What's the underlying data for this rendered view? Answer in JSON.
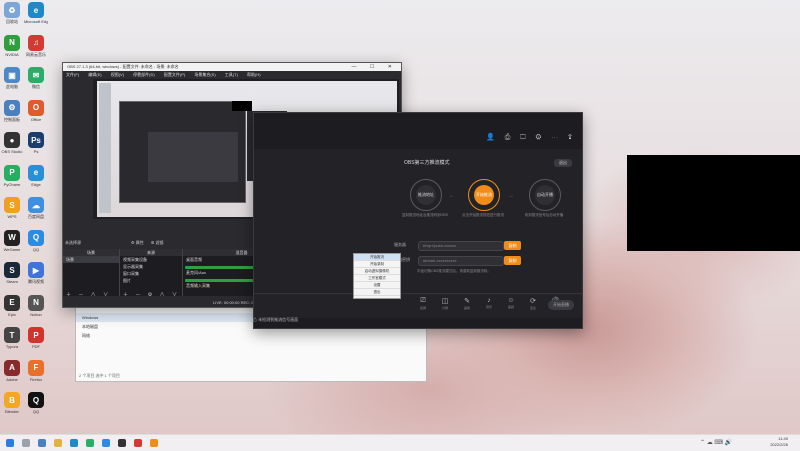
{
  "desktop": {
    "icons": [
      {
        "label": "回收站",
        "color": "#7aa6d8",
        "glyph": "♻"
      },
      {
        "label": "Microsoft Edge",
        "color": "#1e88c8",
        "glyph": "e"
      },
      {
        "label": "NVIDIA",
        "color": "#2f9e3f",
        "glyph": "N"
      },
      {
        "label": "网易云音乐",
        "color": "#d33b32",
        "glyph": "♫"
      },
      {
        "label": "此电脑",
        "color": "#4a88c7",
        "glyph": "▣"
      },
      {
        "label": "微信",
        "color": "#2aae67",
        "glyph": "✉"
      },
      {
        "label": "控制面板",
        "color": "#4a7fc0",
        "glyph": "⚙"
      },
      {
        "label": "Office",
        "color": "#e05a2b",
        "glyph": "O"
      },
      {
        "label": "OBS Studio",
        "color": "#333333",
        "glyph": "●"
      },
      {
        "label": "Ps",
        "color": "#1c3c6e",
        "glyph": "Ps"
      },
      {
        "label": "PyCharm",
        "color": "#27ae60",
        "glyph": "P"
      },
      {
        "label": "Edge",
        "color": "#2c8fd6",
        "glyph": "e"
      },
      {
        "label": "WPS",
        "color": "#f0a020",
        "glyph": "S"
      },
      {
        "label": "百度网盘",
        "color": "#3f8fe0",
        "glyph": "☁"
      },
      {
        "label": "WeGame",
        "color": "#222222",
        "glyph": "W"
      },
      {
        "label": "QQ",
        "color": "#2d8be3",
        "glyph": "Q"
      },
      {
        "label": "Steam",
        "color": "#1b2838",
        "glyph": "S"
      },
      {
        "label": "腾讯视频",
        "color": "#3f74d8",
        "glyph": "▶"
      },
      {
        "label": "Epic",
        "color": "#333333",
        "glyph": "E"
      },
      {
        "label": "Notion",
        "color": "#555555",
        "glyph": "N"
      },
      {
        "label": "Typora",
        "color": "#444444",
        "glyph": "T"
      },
      {
        "label": "PDF",
        "color": "#d2332c",
        "glyph": "P"
      },
      {
        "label": "Adobe",
        "color": "#8a2b2b",
        "glyph": "A"
      },
      {
        "label": "Firefox",
        "color": "#e8702a",
        "glyph": "F"
      },
      {
        "label": "Blender",
        "color": "#f5a623",
        "glyph": "B"
      },
      {
        "label": "QQ",
        "color": "#111111",
        "glyph": "Q"
      }
    ]
  },
  "obs": {
    "title": "OBS 27.1.3 (64-bit, windows) - 配置文件: 未命名 - 场景: 未命名",
    "controls": "—  ☐  ✕",
    "menu": [
      "文件(F)",
      "编辑(E)",
      "视图(V)",
      "停靠部件(D)",
      "配置文件(P)",
      "场景集合(S)",
      "工具(T)",
      "帮助(H)"
    ],
    "no_source": "未选择源",
    "props_btn": "⚙ 属性",
    "filters_btn": "⊞ 滤镜",
    "docks": {
      "scenes": "场景",
      "sources": "来源",
      "mixer": "混音器",
      "transitions": "转场特效",
      "controls": "控件"
    },
    "scenes": [
      "场景"
    ],
    "sources": [
      "视频采集设备",
      "显示器采集",
      "窗口采集",
      "图片"
    ],
    "mixer": [
      "桌面音频",
      "麦克风/Aux",
      "音频输入采集"
    ],
    "transition_label": "淡出",
    "duration_label": "时长",
    "duration_value": "300 ms",
    "control_buttons": [
      "开始推流",
      "开始录制",
      "启动虚拟摄像机",
      "工作室模式",
      "设置",
      "退出"
    ],
    "status": "LIVE: 00:00:00   REC: 00:00:00   CPU: 3.8%, 60.00 fps"
  },
  "explorer": {
    "rows": [
      "Windows",
      "本地磁盘",
      "网络"
    ],
    "footer": "2 个项目   选中 1 个项目"
  },
  "stream": {
    "heading": "OBS第三方推流模式",
    "mode_button": "退出",
    "steps": [
      {
        "label": "推流地址",
        "caption": "复制推流地址及推流码到OBS"
      },
      {
        "label": "开始推流",
        "caption": "点击开始推流按钮进行推流"
      },
      {
        "label": "自动开播",
        "caption": "收到推流信号后自动开播"
      }
    ],
    "rows": [
      {
        "label": "服务器",
        "value": "rtmp://push.xxxxxx",
        "copy": "复制"
      },
      {
        "label": "串流密钥",
        "value": "stream-xxxxxxxxxx",
        "copy": "复制"
      }
    ],
    "hint": "中途切换OBS推流模式后，请重新复制推流码。",
    "toolbar": [
      {
        "glyph": "⎚",
        "label": "投屏"
      },
      {
        "glyph": "◫",
        "label": "分屏"
      },
      {
        "glyph": "✎",
        "label": "画笔"
      },
      {
        "glyph": "♪",
        "label": "音乐"
      },
      {
        "glyph": "☺",
        "label": "美颜"
      },
      {
        "glyph": "⟳",
        "label": "连麦"
      },
      {
        "glyph": "🔊",
        "label": "音量"
      }
    ],
    "live_button": "开始直播",
    "warning": "⚠ 未检测到推流信号画面"
  },
  "taskbar": {
    "time": "11:49",
    "date": "2022/2/26"
  }
}
